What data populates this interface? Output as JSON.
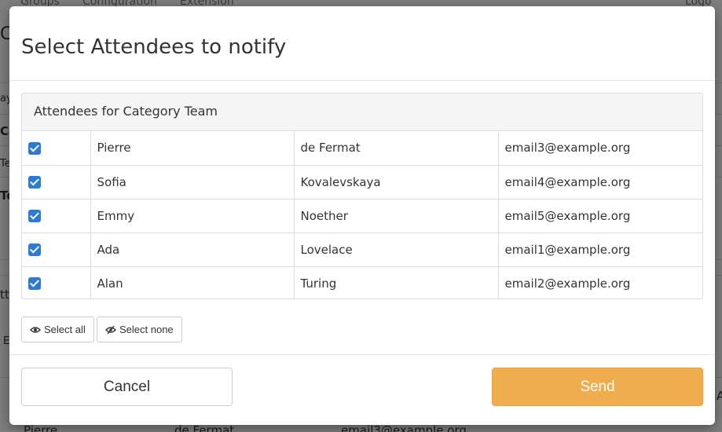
{
  "background": {
    "nav": [
      "Groups",
      "Configuration",
      "Extension",
      "Logo"
    ],
    "edge_fragments": [
      "C",
      "ay",
      "Ca",
      "Te",
      "To",
      "tte",
      "E",
      "A"
    ],
    "row": {
      "first": "Pierre",
      "last": "de Fermat",
      "email": "email3@example.org"
    }
  },
  "modal": {
    "title": "Select Attendees to notify",
    "panel_heading": "Attendees for Category Team",
    "attendees": [
      {
        "checked": true,
        "first": "Pierre",
        "last": "de Fermat",
        "email": "email3@example.org"
      },
      {
        "checked": true,
        "first": "Sofia",
        "last": "Kovalevskaya",
        "email": "email4@example.org"
      },
      {
        "checked": true,
        "first": "Emmy",
        "last": "Noether",
        "email": "email5@example.org"
      },
      {
        "checked": true,
        "first": "Ada",
        "last": "Lovelace",
        "email": "email1@example.org"
      },
      {
        "checked": true,
        "first": "Alan",
        "last": "Turing",
        "email": "email2@example.org"
      }
    ],
    "select_all_label": "Select all",
    "select_none_label": "Select none",
    "cancel_label": "Cancel",
    "send_label": "Send",
    "icons": {
      "select_all": "eye-icon",
      "select_none": "eye-slash-icon"
    },
    "colors": {
      "send": "#f0ad4e",
      "checkbox": "#2a7ad6"
    }
  }
}
